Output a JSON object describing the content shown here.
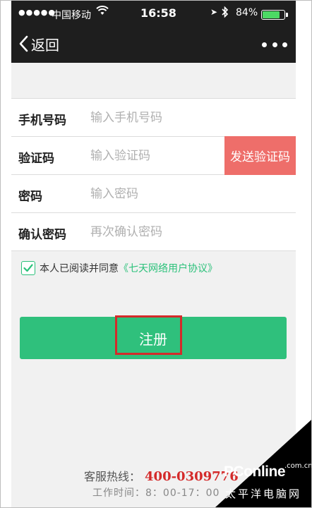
{
  "status_bar": {
    "signal": "●●●●●",
    "carrier": "中国移动",
    "time": "16:58",
    "battery_text": "84%",
    "battery_level": 0.84
  },
  "nav": {
    "back_label": "返回"
  },
  "form": {
    "phone": {
      "label": "手机号码",
      "placeholder": "输入手机号码"
    },
    "code": {
      "label": "验证码",
      "placeholder": "输入验证码",
      "send_label": "发送验证码"
    },
    "password": {
      "label": "密码",
      "placeholder": "输入密码"
    },
    "confirm": {
      "label": "确认密码",
      "placeholder": "再次确认密码"
    }
  },
  "agreement": {
    "checked": true,
    "text": "本人已阅读并同意",
    "link": "《七天网络用户协议》"
  },
  "register_label": "注册",
  "footer": {
    "hotline_label": "客服热线：",
    "hotline_number": "400-0309776",
    "hours": "工作时间：8：00-17：00"
  },
  "watermark": {
    "brand": "PConline",
    "brand_suffix": ".com.cn",
    "cn": "太平洋电脑网"
  },
  "colors": {
    "accent_green": "#2fc07c",
    "send_code_red": "#ee6e6a",
    "hotline_red": "#d42a2a",
    "nav_bg": "#1e1e1e"
  }
}
